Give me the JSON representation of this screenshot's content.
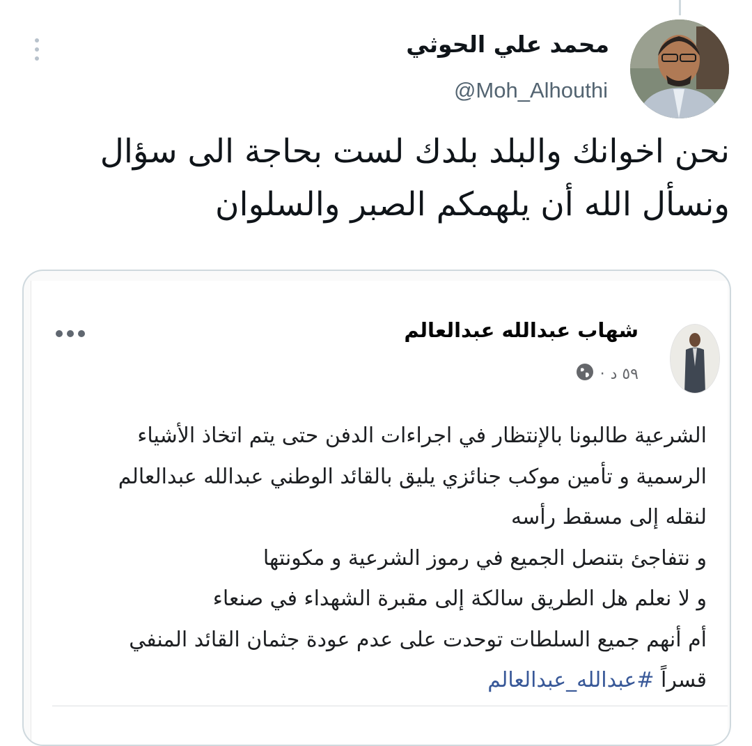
{
  "tweet": {
    "display_name": "محمد علي الحوثي",
    "handle": "@Moh_Alhouthi",
    "text_lines": [
      "نحن اخوانك والبلد بلدك لست بحاجة الى سؤال",
      "ونسأل الله أن يلهمكم الصبر والسلوان"
    ]
  },
  "embedded_post": {
    "author_name": "شهاب عبدالله عبدالعالم",
    "time": "٥٩ د",
    "separator": "·",
    "privacy_icon": "globe-icon",
    "more_icon": "horizontal-dots-icon",
    "body_lines": [
      "الشرعية طالبونا بالإنتظار في اجراءات الدفن حتى يتم اتخاذ الأشياء",
      "الرسمية و تأمين موكب جنائزي يليق بالقائد الوطني عبدالله عبدالعالم",
      "لنقله إلى مسقط رأسه",
      "و نتفاجئ بتنصل الجميع في رموز الشرعية و مكونتها",
      "و لا نعلم هل الطريق سالكة إلى مقبرة الشهداء في صنعاء",
      "أم أنهم جميع السلطات توحدت على عدم عودة جثمان القائد المنفي"
    ],
    "last_line_prefix": "قسراً ",
    "hashtag": "#عبدالله_عبدالعالم"
  },
  "colors": {
    "text": "#0f1419",
    "secondary": "#536471",
    "hashtag": "#385898",
    "border": "#cfd9de"
  }
}
